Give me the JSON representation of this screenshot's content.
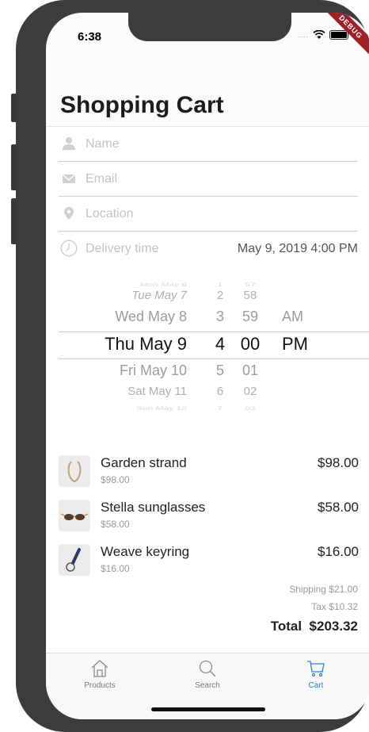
{
  "status_bar": {
    "time": "6:38",
    "signal": "....",
    "debug_label": "DEBUG"
  },
  "title": "Shopping Cart",
  "form": {
    "name_placeholder": "Name",
    "email_placeholder": "Email",
    "location_placeholder": "Location",
    "delivery_label": "Delivery time",
    "delivery_value": "May 9, 2019 4:00 PM"
  },
  "picker": {
    "rows": [
      {
        "day": "Mon May 6",
        "hour": "1",
        "minute": "57",
        "ampm": ""
      },
      {
        "day": "Tue May 7",
        "hour": "2",
        "minute": "58",
        "ampm": ""
      },
      {
        "day": "Wed May 8",
        "hour": "3",
        "minute": "59",
        "ampm": "AM"
      },
      {
        "day": "Thu May 9",
        "hour": "4",
        "minute": "00",
        "ampm": "PM"
      },
      {
        "day": "Fri May 10",
        "hour": "5",
        "minute": "01",
        "ampm": ""
      },
      {
        "day": "Sat May 11",
        "hour": "6",
        "minute": "02",
        "ampm": ""
      },
      {
        "day": "Sun May 12",
        "hour": "7",
        "minute": "03",
        "ampm": ""
      }
    ]
  },
  "cart": {
    "items": [
      {
        "name": "Garden strand",
        "unit_price": "$98.00",
        "price": "$98.00"
      },
      {
        "name": "Stella sunglasses",
        "unit_price": "$58.00",
        "price": "$58.00"
      },
      {
        "name": "Weave keyring",
        "unit_price": "$16.00",
        "price": "$16.00"
      }
    ],
    "shipping": "Shipping $21.00",
    "tax": "Tax $10.32",
    "total": "Total  $203.32"
  },
  "tabs": [
    {
      "label": "Products",
      "icon": "home-icon"
    },
    {
      "label": "Search",
      "icon": "search-icon"
    },
    {
      "label": "Cart",
      "icon": "cart-icon",
      "active": true
    }
  ],
  "colors": {
    "accent": "#2a7de1",
    "debug": "#a0202a"
  }
}
